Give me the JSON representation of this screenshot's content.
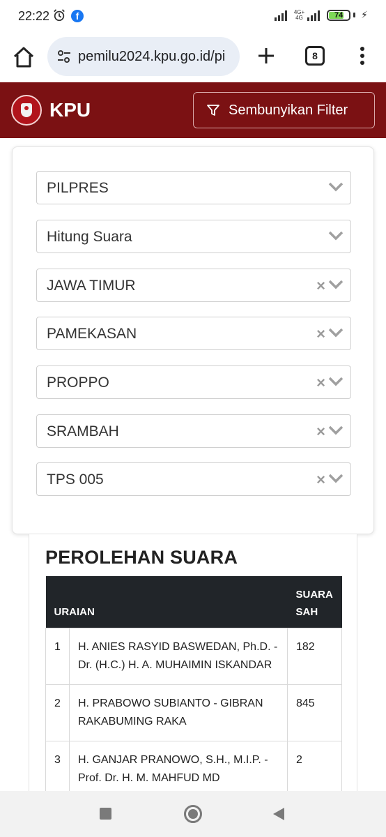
{
  "status_bar": {
    "time": "22:22",
    "network_top": "4G+",
    "network_bottom": "4G",
    "battery": "74",
    "battery_level": 0.74,
    "icons": [
      "alarm-icon",
      "facebook-icon",
      "signal-icon",
      "battery-icon",
      "charging-icon"
    ]
  },
  "browser": {
    "url": "pemilu2024.kpu.go.id/pi",
    "tab_count": "8",
    "url_bar_color": "#e9eef6"
  },
  "header": {
    "title": "KPU",
    "filter_button": "Sembunyikan Filter",
    "background_color": "#7b1113"
  },
  "filters": [
    {
      "value": "PILPRES",
      "clearable": false
    },
    {
      "value": "Hitung Suara",
      "clearable": false
    },
    {
      "value": "JAWA TIMUR",
      "clearable": true
    },
    {
      "value": "PAMEKASAN",
      "clearable": true
    },
    {
      "value": "PROPPO",
      "clearable": true
    },
    {
      "value": "SRAMBAH",
      "clearable": true
    },
    {
      "value": "TPS 005",
      "clearable": true
    }
  ],
  "results": {
    "title": "PEROLEHAN SUARA",
    "headers": {
      "uraian": "URAIAN",
      "suara_sah_1": "SUARA",
      "suara_sah_2": "SAH"
    },
    "rows": [
      {
        "no": "1",
        "name_line1": "H. ANIES RASYID BASWEDAN, Ph.D. -",
        "name_line2": "Dr. (H.C.) H. A. MUHAIMIN ISKANDAR",
        "votes": "182"
      },
      {
        "no": "2",
        "name_line1": "H. PRABOWO SUBIANTO - GIBRAN",
        "name_line2": "RAKABUMING RAKA",
        "votes": "845"
      },
      {
        "no": "3",
        "name_line1": "H. GANJAR PRANOWO, S.H., M.I.P. -",
        "name_line2": "Prof. Dr. H. M. MAHFUD MD",
        "votes": "2"
      }
    ]
  }
}
